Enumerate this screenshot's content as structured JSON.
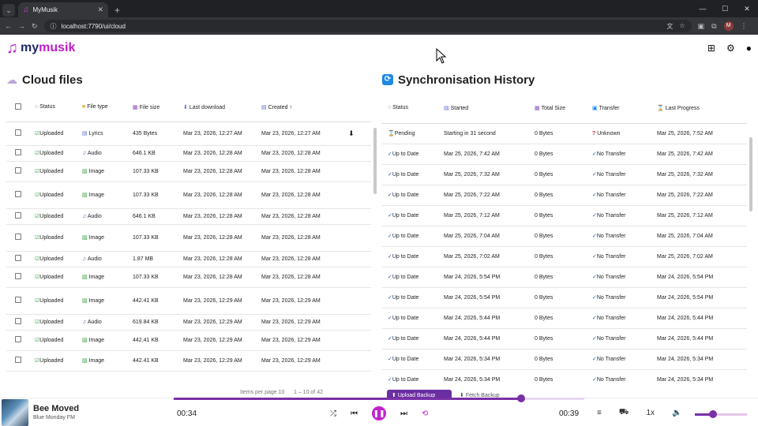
{
  "browser": {
    "tab_title": "MyMusik",
    "url": "localhost:7790/ui/cloud"
  },
  "app": {
    "logo_part1": "my",
    "logo_part2": "musik"
  },
  "cloud": {
    "title": "Cloud files",
    "columns": [
      "Status",
      "File type",
      "File size",
      "Last download",
      "Created"
    ],
    "rows": [
      {
        "status": "Uploaded",
        "type": "Lyrics",
        "size": "435 Bytes",
        "last": "Mar 23, 2026, 12:27 AM",
        "created": "Mar 23, 2026, 12:27 AM",
        "download": true
      },
      {
        "status": "Uploaded",
        "type": "Audio",
        "size": "646.1 KB",
        "last": "Mar 23, 2026, 12:28 AM",
        "created": "Mar 23, 2026, 12:28 AM"
      },
      {
        "status": "Uploaded",
        "type": "Image",
        "size": "107.33 KB",
        "last": "Mar 23, 2026, 12:28 AM",
        "created": "Mar 23, 2026, 12:28 AM"
      },
      {
        "status": "Uploaded",
        "type": "Image",
        "size": "107.33 KB",
        "last": "Mar 23, 2026, 12:28 AM",
        "created": "Mar 23, 2026, 12:28 AM"
      },
      {
        "status": "Uploaded",
        "type": "Audio",
        "size": "646.1 KB",
        "last": "Mar 23, 2026, 12:28 AM",
        "created": "Mar 23, 2026, 12:28 AM"
      },
      {
        "status": "Uploaded",
        "type": "Image",
        "size": "107.33 KB",
        "last": "Mar 23, 2026, 12:28 AM",
        "created": "Mar 23, 2026, 12:28 AM"
      },
      {
        "status": "Uploaded",
        "type": "Audio",
        "size": "1.87 MB",
        "last": "Mar 23, 2026, 12:28 AM",
        "created": "Mar 23, 2026, 12:28 AM"
      },
      {
        "status": "Uploaded",
        "type": "Image",
        "size": "107.33 KB",
        "last": "Mar 23, 2026, 12:28 AM",
        "created": "Mar 23, 2026, 12:28 AM"
      },
      {
        "status": "Uploaded",
        "type": "Image",
        "size": "442.41 KB",
        "last": "Mar 23, 2026, 12:29 AM",
        "created": "Mar 23, 2026, 12:29 AM"
      },
      {
        "status": "Uploaded",
        "type": "Audio",
        "size": "619.84 KB",
        "last": "Mar 23, 2026, 12:29 AM",
        "created": "Mar 23, 2026, 12:29 AM"
      },
      {
        "status": "Uploaded",
        "type": "Image",
        "size": "442.41 KB",
        "last": "Mar 23, 2026, 12:29 AM",
        "created": "Mar 23, 2026, 12:29 AM"
      },
      {
        "status": "Uploaded",
        "type": "Image",
        "size": "442.41 KB",
        "last": "Mar 23, 2026, 12:29 AM",
        "created": "Mar 23, 2026, 12:29 AM"
      }
    ],
    "pagination_text": "Items per page  10",
    "range_text": "1 – 10 of 42"
  },
  "sync": {
    "title": "Synchronisation History",
    "columns": [
      "Status",
      "Started",
      "Total Size",
      "Transfer",
      "Last Progress"
    ],
    "rows": [
      {
        "status": "Pending",
        "started": "Starting in 31 second",
        "size": "0 Bytes",
        "transfer": "Unknown",
        "last": "Mar 25, 2026, 7:52 AM"
      },
      {
        "status": "Up to Date",
        "started": "Mar 25, 2026, 7:42 AM",
        "size": "0 Bytes",
        "transfer": "No Transfer",
        "last": "Mar 25, 2026, 7:42 AM"
      },
      {
        "status": "Up to Date",
        "started": "Mar 25, 2026, 7:32 AM",
        "size": "0 Bytes",
        "transfer": "No Transfer",
        "last": "Mar 25, 2026, 7:32 AM"
      },
      {
        "status": "Up to Date",
        "started": "Mar 25, 2026, 7:22 AM",
        "size": "0 Bytes",
        "transfer": "No Transfer",
        "last": "Mar 25, 2026, 7:22 AM"
      },
      {
        "status": "Up to Date",
        "started": "Mar 25, 2026, 7:12 AM",
        "size": "0 Bytes",
        "transfer": "No Transfer",
        "last": "Mar 25, 2026, 7:12 AM"
      },
      {
        "status": "Up to Date",
        "started": "Mar 25, 2026, 7:04 AM",
        "size": "0 Bytes",
        "transfer": "No Transfer",
        "last": "Mar 25, 2026, 7:04 AM"
      },
      {
        "status": "Up to Date",
        "started": "Mar 25, 2026, 7:02 AM",
        "size": "0 Bytes",
        "transfer": "No Transfer",
        "last": "Mar 25, 2026, 7:02 AM"
      },
      {
        "status": "Up to Date",
        "started": "Mar 24, 2026, 5:54 PM",
        "size": "0 Bytes",
        "transfer": "No Transfer",
        "last": "Mar 24, 2026, 5:54 PM"
      },
      {
        "status": "Up to Date",
        "started": "Mar 24, 2026, 5:54 PM",
        "size": "0 Bytes",
        "transfer": "No Transfer",
        "last": "Mar 24, 2026, 5:54 PM"
      },
      {
        "status": "Up to Date",
        "started": "Mar 24, 2026, 5:44 PM",
        "size": "0 Bytes",
        "transfer": "No Transfer",
        "last": "Mar 24, 2026, 5:44 PM"
      },
      {
        "status": "Up to Date",
        "started": "Mar 24, 2026, 5:44 PM",
        "size": "0 Bytes",
        "transfer": "No Transfer",
        "last": "Mar 24, 2026, 5:44 PM"
      },
      {
        "status": "Up to Date",
        "started": "Mar 24, 2026, 5:34 PM",
        "size": "0 Bytes",
        "transfer": "No Transfer",
        "last": "Mar 24, 2026, 5:34 PM"
      },
      {
        "status": "Up to Date",
        "started": "Mar 24, 2026, 5:34 PM",
        "size": "0 Bytes",
        "transfer": "No Transfer",
        "last": "Mar 24, 2026, 5:34 PM"
      }
    ],
    "upload_backup": "Upload Backup",
    "fetch_backup": "Fetch Backup"
  },
  "player": {
    "title": "Bee Moved",
    "artist": "Blue Monday FM",
    "elapsed": "00:34",
    "duration": "00:39",
    "speed": "1x",
    "progress_fraction": 0.846,
    "volume_fraction": 0.35
  }
}
